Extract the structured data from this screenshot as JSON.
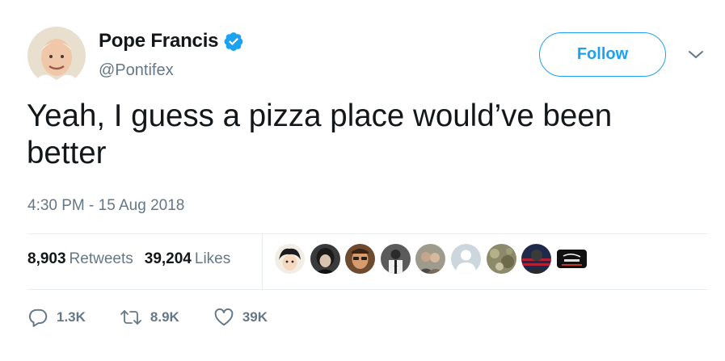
{
  "author": {
    "display_name": "Pope Francis",
    "handle": "@Pontifex",
    "verified": true,
    "avatar_icon": "pope-portrait-avatar"
  },
  "follow_label": "Follow",
  "menu_icon": "chevron-down-icon",
  "tweet": {
    "text": "Yeah, I guess a pizza place would’ve been better",
    "timestamp": "4:30 PM - 15 Aug 2018"
  },
  "stats": {
    "retweets_count": "8,903",
    "retweets_label": "Retweets",
    "likes_count": "39,204",
    "likes_label": "Likes"
  },
  "likers": [
    "liker-avatar-1",
    "liker-avatar-2",
    "liker-avatar-3",
    "liker-avatar-4",
    "liker-avatar-5",
    "liker-avatar-6",
    "liker-avatar-7",
    "liker-avatar-8",
    "liker-avatar-9"
  ],
  "actions": {
    "reply_count": "1.3K",
    "retweet_count": "8.9K",
    "like_count": "39K"
  },
  "colors": {
    "accent": "#1da1f2",
    "text": "#14171a",
    "secondary_text": "#657786",
    "divider": "#e6ecf0"
  }
}
